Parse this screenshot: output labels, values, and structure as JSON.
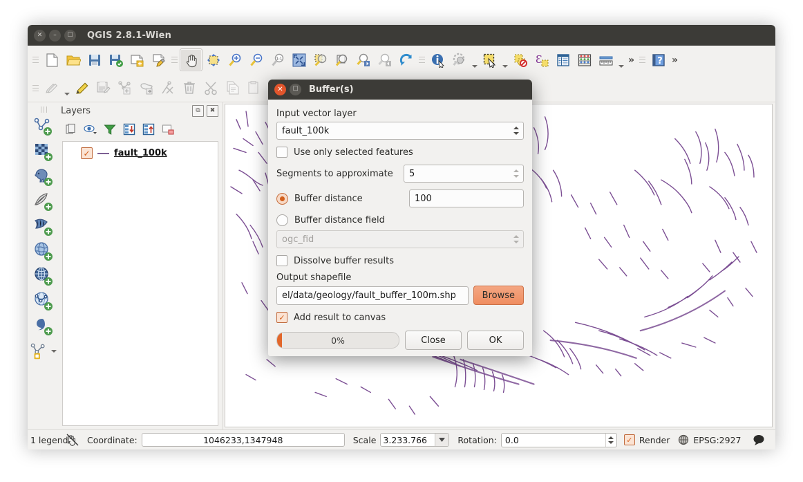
{
  "window": {
    "title": "QGIS 2.8.1-Wien",
    "controls": [
      "close",
      "minimize",
      "maximize"
    ]
  },
  "toolbars": {
    "row1": [
      {
        "name": "new-project-icon",
        "label": "New Project"
      },
      {
        "name": "open-project-icon",
        "label": "Open Project"
      },
      {
        "name": "save-project-icon",
        "label": "Save Project"
      },
      {
        "name": "save-project-as-icon",
        "label": "Save Project As"
      },
      {
        "name": "new-print-composer-icon",
        "label": "New Print Composer"
      },
      {
        "name": "composer-manager-icon",
        "label": "Composer Manager"
      },
      {
        "name": "pan-map-icon",
        "label": "Pan Map"
      },
      {
        "name": "pan-to-selection-icon",
        "label": "Pan Map to Selection"
      },
      {
        "name": "zoom-in-icon",
        "label": "Zoom In"
      },
      {
        "name": "zoom-out-icon",
        "label": "Zoom Out"
      },
      {
        "name": "zoom-native-icon",
        "label": "Zoom to Native Resolution"
      },
      {
        "name": "zoom-full-icon",
        "label": "Zoom Full"
      },
      {
        "name": "zoom-to-selection-icon",
        "label": "Zoom to Selection"
      },
      {
        "name": "zoom-to-layer-icon",
        "label": "Zoom to Layer"
      },
      {
        "name": "zoom-last-icon",
        "label": "Zoom Last"
      },
      {
        "name": "zoom-next-icon",
        "label": "Zoom Next"
      },
      {
        "name": "refresh-icon",
        "label": "Refresh"
      },
      {
        "name": "identify-features-icon",
        "label": "Identify Features"
      },
      {
        "name": "map-tips-icon",
        "label": "Show Map Tips"
      },
      {
        "name": "select-features-icon",
        "label": "Select Features by Area"
      },
      {
        "name": "deselect-features-icon",
        "label": "Deselect Features"
      },
      {
        "name": "select-by-expression-icon",
        "label": "Select by Expression"
      },
      {
        "name": "open-attribute-table-icon",
        "label": "Open Attribute Table"
      },
      {
        "name": "field-calculator-icon",
        "label": "Open Field Calculator"
      },
      {
        "name": "measure-line-icon",
        "label": "Measure Line"
      },
      {
        "name": "toolbar-overflow-icon",
        "label": "More"
      },
      {
        "name": "help-icon",
        "label": "Help"
      },
      {
        "name": "toolbar-overflow-2-icon",
        "label": "More"
      }
    ],
    "row2": [
      {
        "name": "current-edits-icon",
        "label": "Current Edits"
      },
      {
        "name": "toggle-editing-icon",
        "label": "Toggle Editing"
      },
      {
        "name": "save-layer-edits-icon",
        "label": "Save Layer Edits"
      },
      {
        "name": "add-feature-icon",
        "label": "Add Feature"
      },
      {
        "name": "move-feature-icon",
        "label": "Move Feature"
      },
      {
        "name": "node-tool-icon",
        "label": "Node Tool"
      },
      {
        "name": "delete-selected-icon",
        "label": "Delete Selected"
      },
      {
        "name": "cut-features-icon",
        "label": "Cut Features"
      },
      {
        "name": "copy-features-icon",
        "label": "Copy Features"
      },
      {
        "name": "paste-features-icon",
        "label": "Paste Features"
      }
    ]
  },
  "left_rail": [
    {
      "name": "add-vector-layer-icon",
      "label": "Add Vector Layer"
    },
    {
      "name": "add-raster-layer-icon",
      "label": "Add Raster Layer"
    },
    {
      "name": "add-postgis-layer-icon",
      "label": "Add PostGIS Layer"
    },
    {
      "name": "add-spatialite-layer-icon",
      "label": "Add SpatiaLite Layer"
    },
    {
      "name": "add-mssql-layer-icon",
      "label": "Add MSSQL Spatial Layer"
    },
    {
      "name": "add-wms-layer-icon",
      "label": "Add WMS/WMTS Layer"
    },
    {
      "name": "add-wcs-layer-icon",
      "label": "Add WCS Layer"
    },
    {
      "name": "add-wfs-layer-icon",
      "label": "Add WFS Layer"
    },
    {
      "name": "add-delimited-text-layer-icon",
      "label": "Add Delimited Text Layer"
    },
    {
      "name": "new-shapefile-layer-icon",
      "label": "New Shapefile Layer"
    }
  ],
  "layers_panel": {
    "title": "Layers",
    "header_buttons": [
      {
        "name": "float-panel-button",
        "glyph": "⧉"
      },
      {
        "name": "close-panel-button",
        "glyph": "✖"
      }
    ],
    "tools": [
      {
        "name": "add-group-icon",
        "label": "Add Group"
      },
      {
        "name": "manage-layer-visibility-icon",
        "label": "Manage Layer Visibility"
      },
      {
        "name": "filter-legend-icon",
        "label": "Filter Legend by Map Content"
      },
      {
        "name": "expand-all-icon",
        "label": "Expand All"
      },
      {
        "name": "collapse-all-icon",
        "label": "Collapse All"
      },
      {
        "name": "remove-layer-icon",
        "label": "Remove Layer/Group"
      }
    ],
    "layers": [
      {
        "name": "fault_100k",
        "checked": true,
        "symbol_color": "#7c5f93"
      }
    ]
  },
  "dialog": {
    "title": "Buffer(s)",
    "input_layer_label": "Input vector layer",
    "input_layer_value": "fault_100k",
    "use_selected_label": "Use only selected features",
    "use_selected_checked": false,
    "segments_label": "Segments to approximate",
    "segments_value": "5",
    "buffer_distance_label": "Buffer distance",
    "buffer_distance_selected": true,
    "buffer_distance_value": "100",
    "buffer_field_label": "Buffer distance field",
    "buffer_field_selected": false,
    "buffer_field_value": "ogc_fid",
    "dissolve_label": "Dissolve buffer results",
    "dissolve_checked": false,
    "output_label": "Output shapefile",
    "output_value": "el/data/geology/fault_buffer_100m.shp",
    "browse_label": "Browse",
    "add_to_canvas_label": "Add result to canvas",
    "add_to_canvas_checked": true,
    "progress_text": "0%",
    "progress_value": 0,
    "close_label": "Close",
    "ok_label": "OK",
    "accent_color": "#e2672b"
  },
  "statusbar": {
    "legend_text": "1 legend",
    "messages_icon": "messages-icon",
    "coordinate_label": "Coordinate:",
    "coordinate_value": "1046233,1347948",
    "scale_label": "Scale",
    "scale_value": "3.233.766",
    "rotation_label": "Rotation:",
    "rotation_value": "0.0",
    "render_label": "Render",
    "render_checked": true,
    "crs_label": "EPSG:2927",
    "crs_icon": "globe-icon",
    "messages_bubble_icon": "speech-bubble-icon"
  },
  "map": {
    "background": "#ffffff",
    "fault_color": "#7c4f94"
  }
}
